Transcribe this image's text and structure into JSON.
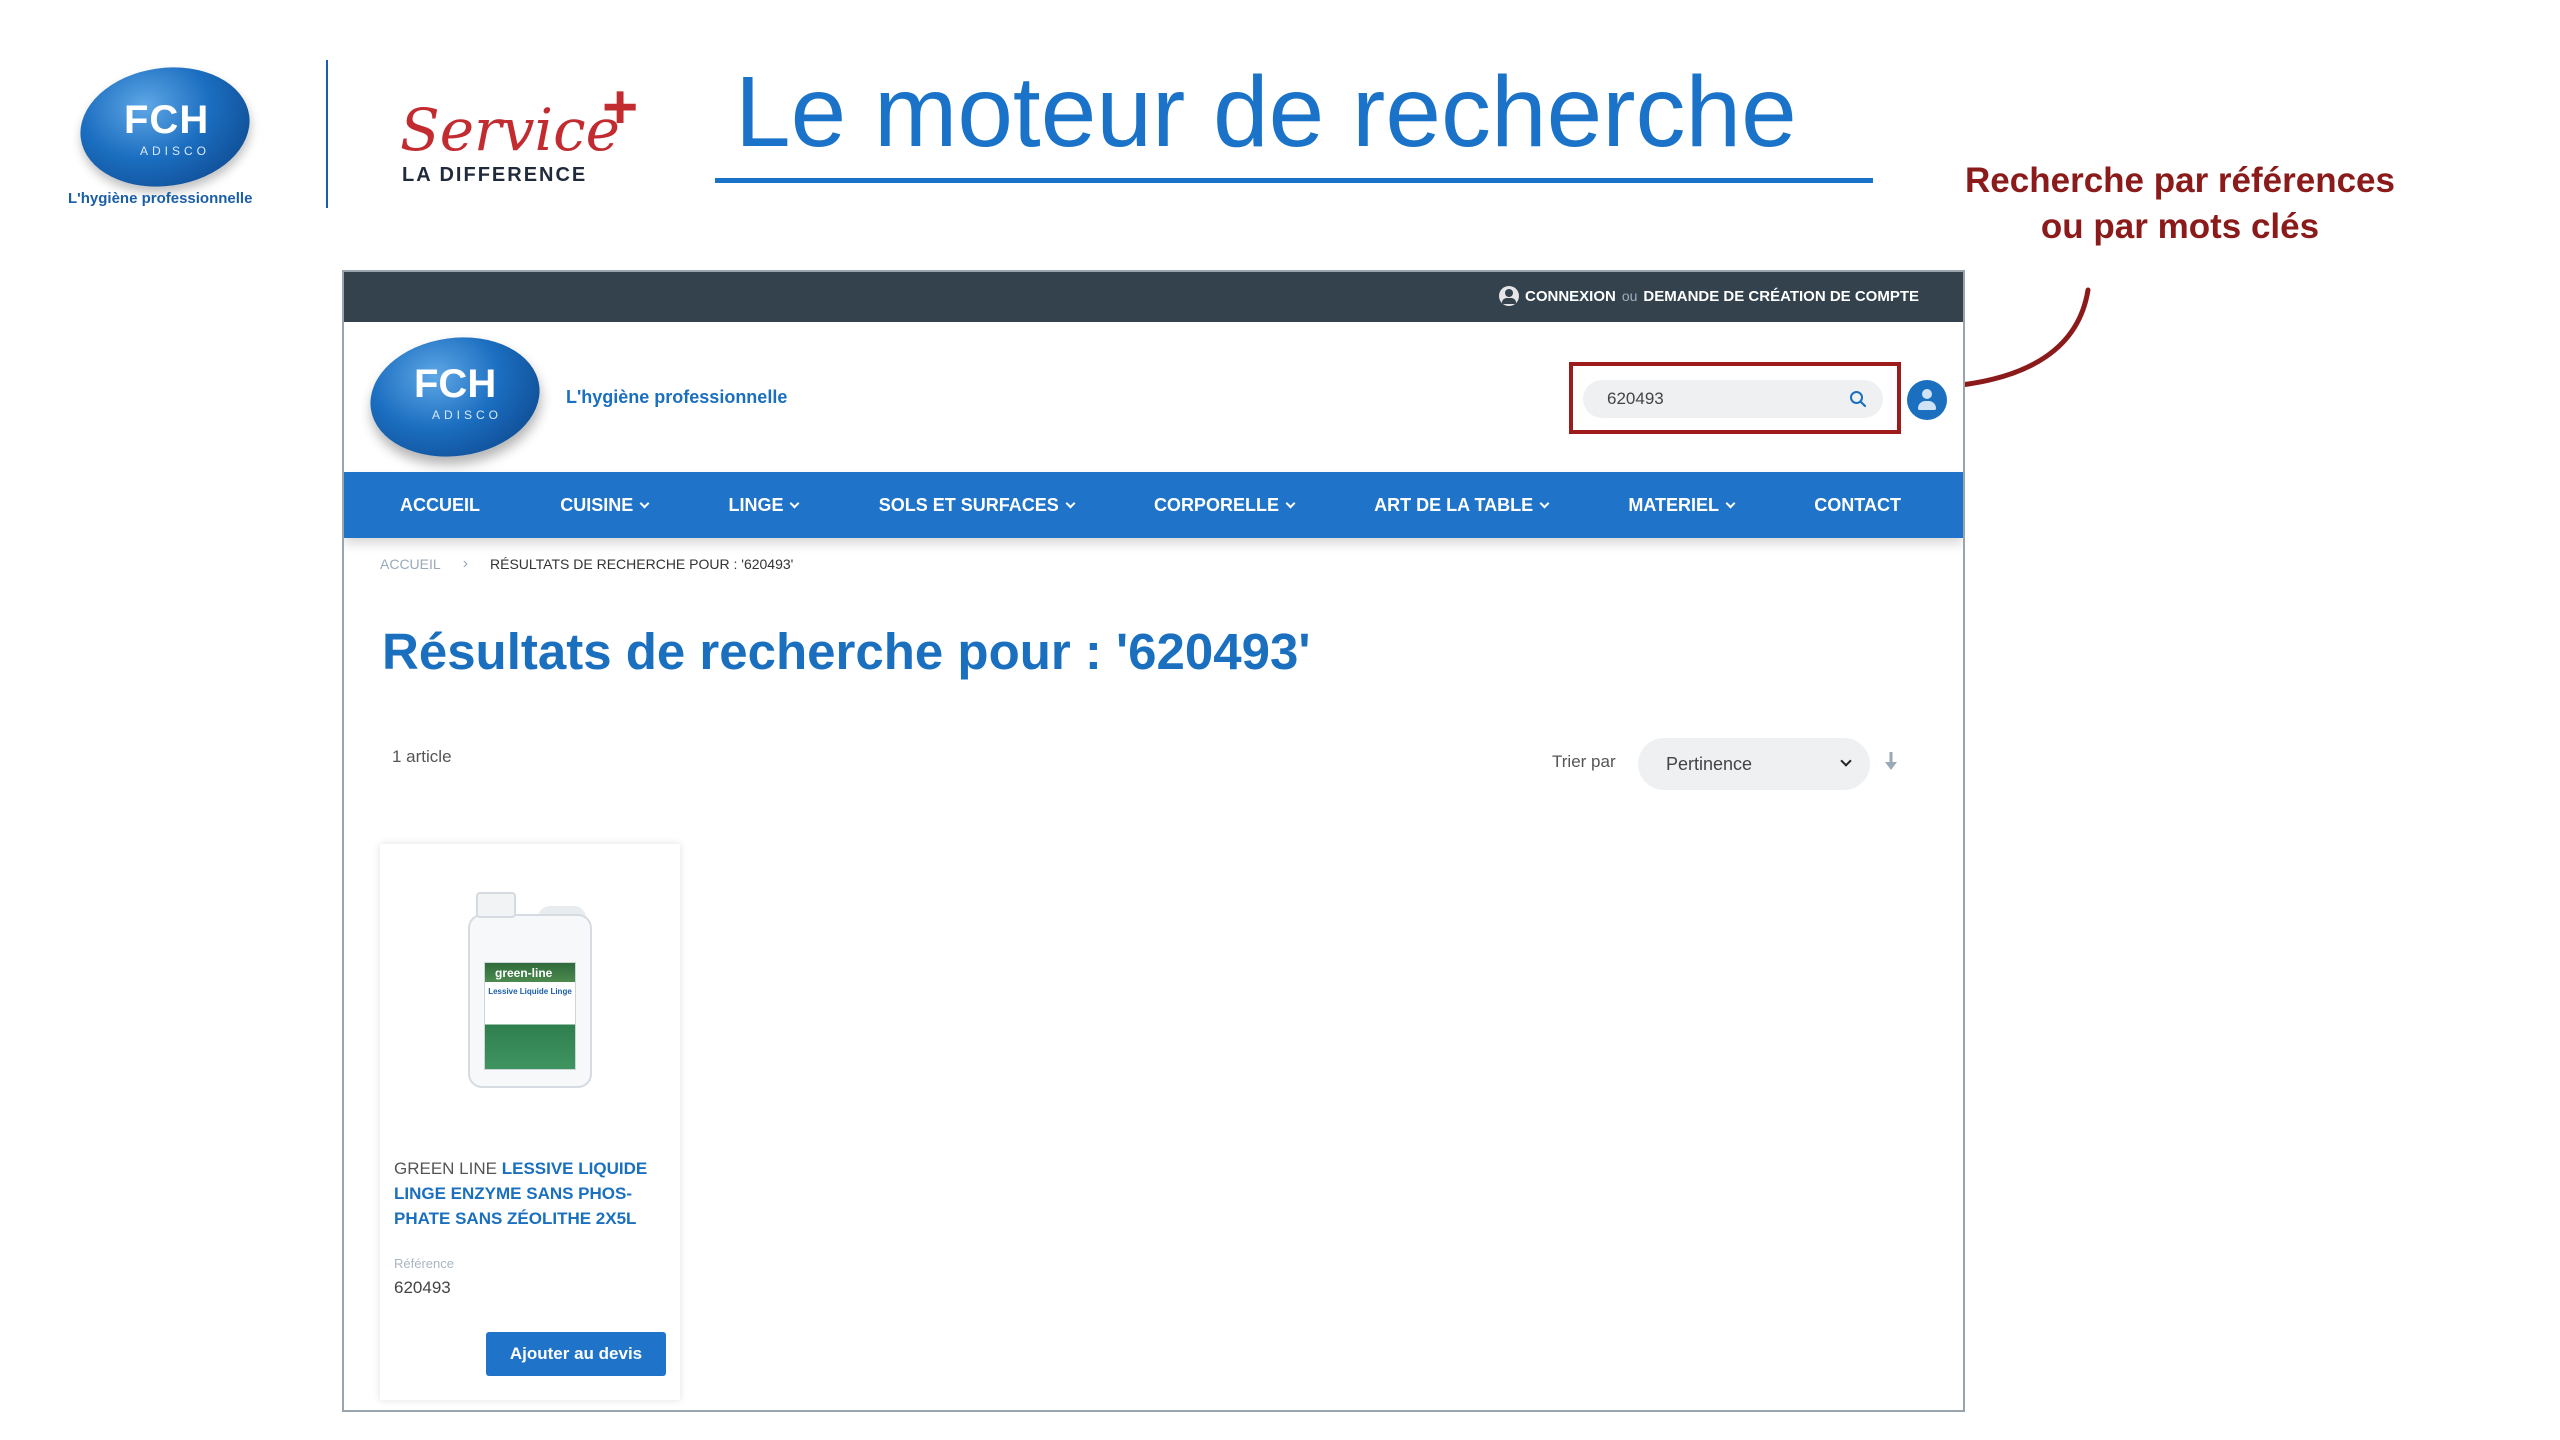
{
  "slide": {
    "logo_text": "FCH",
    "logo_sub": "ADISCO",
    "logo_tagline": "L'hygiène professionnelle",
    "service_script": "Service",
    "service_plus": "+",
    "service_sub": "LA DIFFERENCE",
    "title": "Le moteur de recherche",
    "annotation_line1": "Recherche par références",
    "annotation_line2": "ou par mots clés",
    "colors": {
      "title_blue": "#1a73c8",
      "annotation_red": "#8b1a1a"
    }
  },
  "site": {
    "topbar": {
      "login": "CONNEXION",
      "or": "ou",
      "signup": "DEMANDE DE CRÉATION DE COMPTE"
    },
    "header": {
      "logo_text": "FCH",
      "logo_sub": "ADISCO",
      "tagline": "L'hygiène professionnelle",
      "search_value": "620493"
    },
    "nav": {
      "items": [
        {
          "label": "ACCUEIL",
          "dropdown": false
        },
        {
          "label": "CUISINE",
          "dropdown": true
        },
        {
          "label": "LINGE",
          "dropdown": true
        },
        {
          "label": "SOLS ET SURFACES",
          "dropdown": true
        },
        {
          "label": "CORPORELLE",
          "dropdown": true
        },
        {
          "label": "ART DE LA TABLE",
          "dropdown": true
        },
        {
          "label": "MATERIEL",
          "dropdown": true
        },
        {
          "label": "CONTACT",
          "dropdown": false
        }
      ]
    },
    "breadcrumb": {
      "home": "ACCUEIL",
      "sep": "›",
      "current": "RÉSULTATS DE RECHERCHE POUR : '620493'"
    },
    "results": {
      "title": "Résultats de recherche pour : '620493'",
      "count": "1 article",
      "sort_label": "Trier par",
      "sort_value": "Pertinence"
    },
    "product": {
      "image_brand": "green-line",
      "image_product": "Lessive Liquide Linge",
      "brand": "GREEN LINE",
      "name": "LESSIVE LIQUIDE LINGE ENZYME SANS PHOS-PHATE SANS ZÉOLITHE 2X5L",
      "ref_label": "Référence",
      "ref_value": "620493",
      "button": "Ajouter au devis"
    },
    "colors": {
      "topbar": "#33424d",
      "nav": "#1f73c9",
      "highlight_border": "#9e1b1b"
    }
  }
}
